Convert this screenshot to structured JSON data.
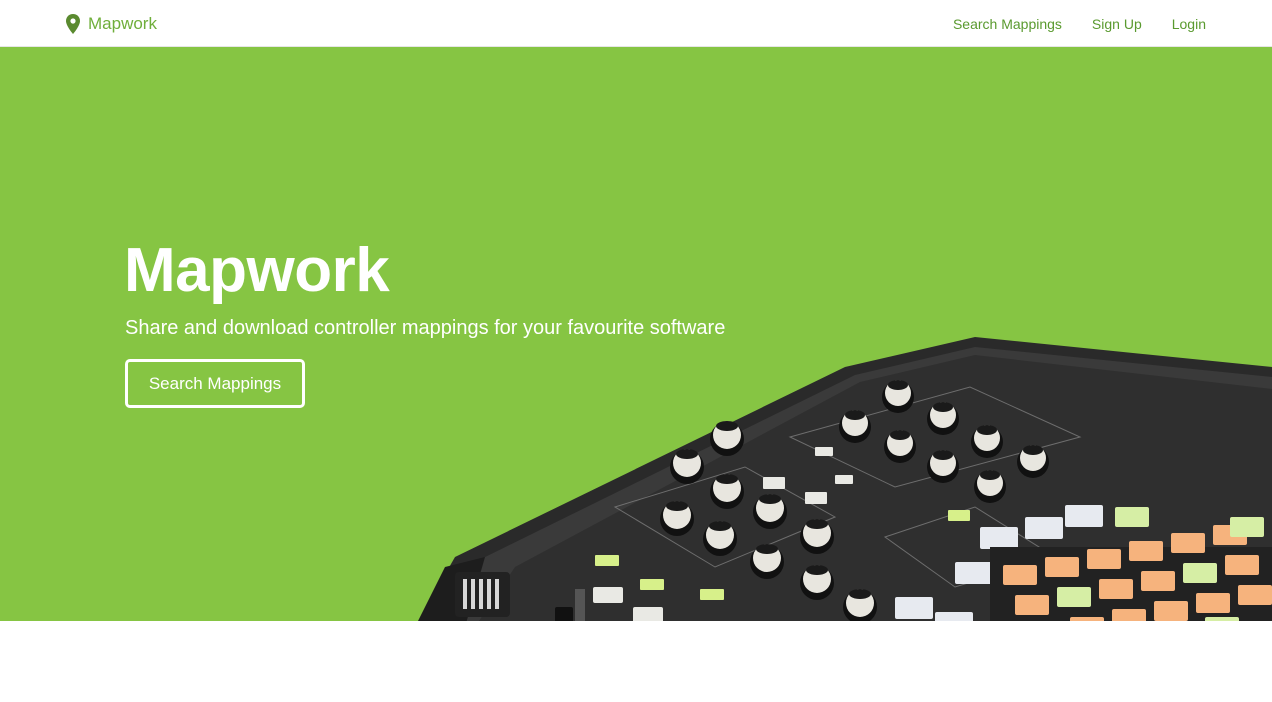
{
  "navbar": {
    "brand_label": "Mapwork",
    "brand_icon": "map-marker-icon",
    "links": [
      {
        "label": "Search Mappings"
      },
      {
        "label": "Sign Up"
      },
      {
        "label": "Login"
      }
    ]
  },
  "hero": {
    "title": "Mapwork",
    "subtitle": "Share and download controller mappings for your favourite software",
    "cta_label": "Search Mappings",
    "background_color": "#86c543"
  },
  "colors": {
    "brand": "#6fae3a",
    "hero_bg": "#86c543",
    "text_light": "#ffffff"
  }
}
